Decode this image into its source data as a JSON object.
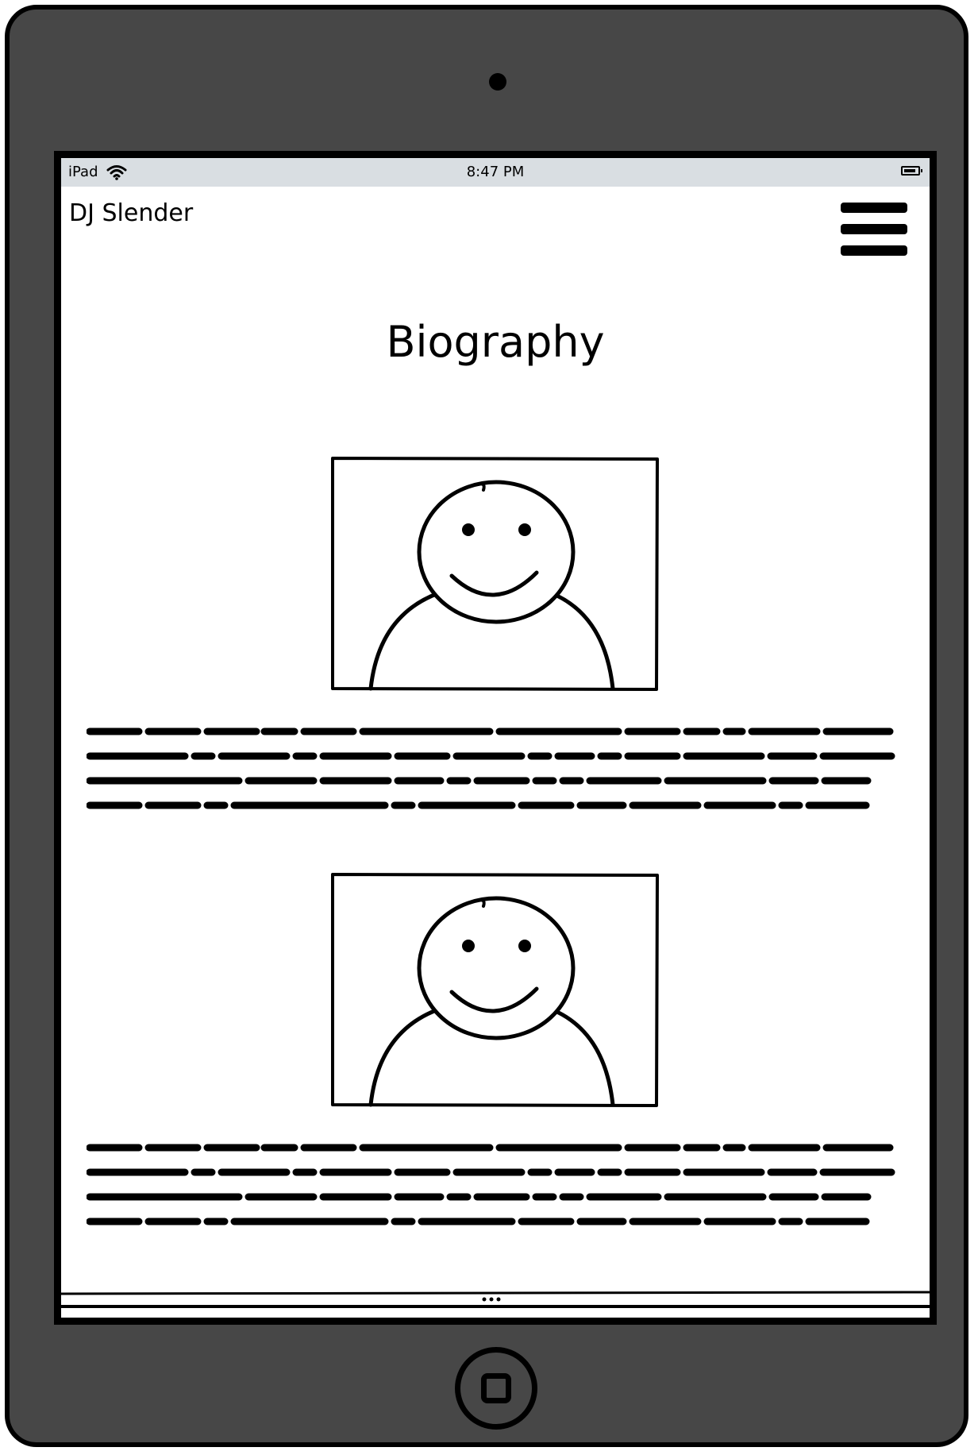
{
  "device": {
    "model_label": "iPad",
    "time": "8:47 PM"
  },
  "header": {
    "app_title": "DJ Slender",
    "menu_icon": "hamburger-menu-icon"
  },
  "page": {
    "title": "Biography"
  },
  "sections": [
    {
      "image_icon": "person-placeholder-icon",
      "paragraph_type": "placeholder-text"
    },
    {
      "image_icon": "person-placeholder-icon",
      "paragraph_type": "placeholder-text"
    }
  ],
  "colors": {
    "device_body": "#474747",
    "status_bar": "#d9dee2",
    "ink": "#000000",
    "screen": "#ffffff"
  }
}
